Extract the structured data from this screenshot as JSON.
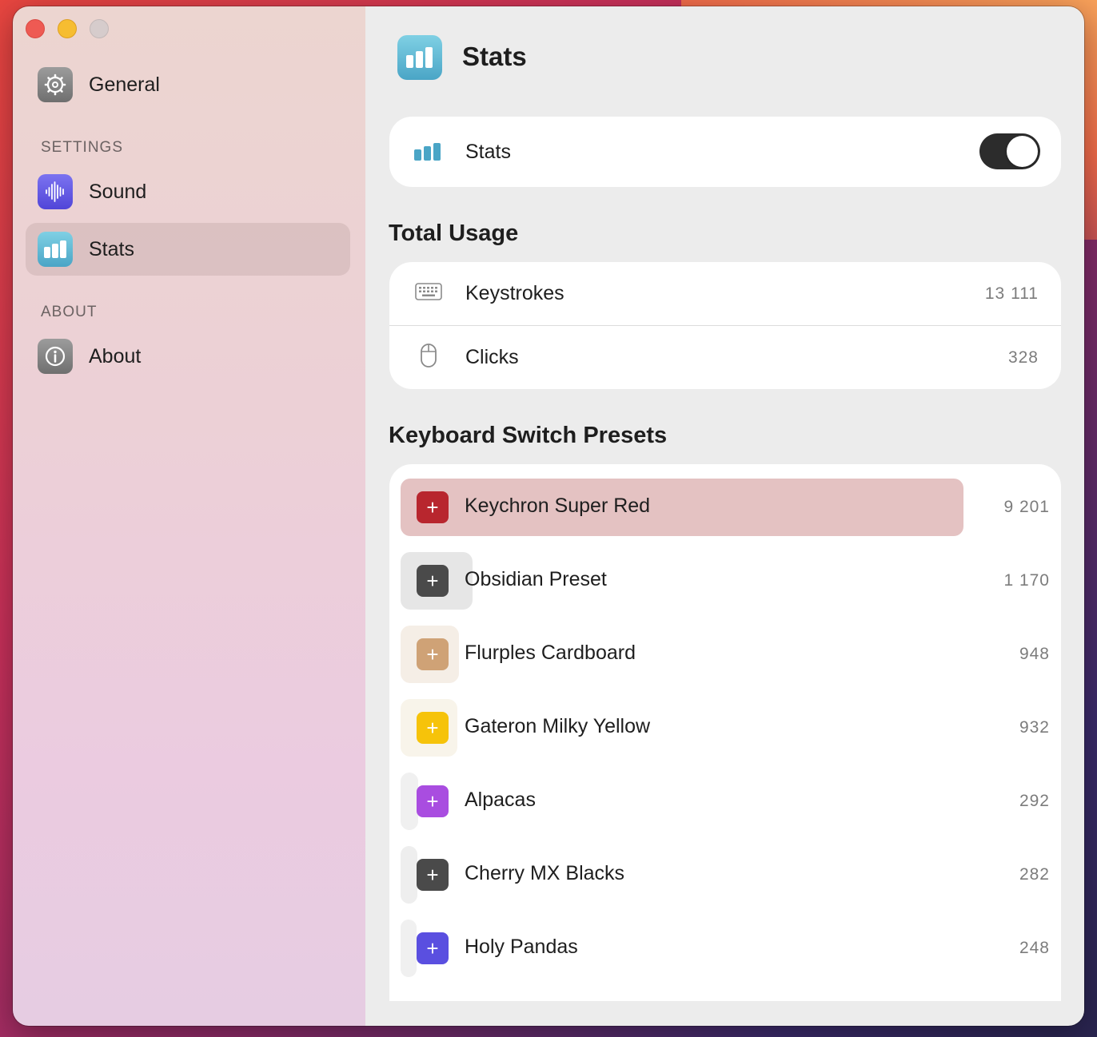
{
  "window": {
    "controls": [
      "close",
      "minimize",
      "zoom"
    ]
  },
  "sidebar": {
    "general": {
      "label": "General",
      "icon": "gear-icon"
    },
    "settings_header": "SETTINGS",
    "settings_items": [
      {
        "label": "Sound",
        "icon": "waveform-icon"
      },
      {
        "label": "Stats",
        "icon": "bar-chart-icon",
        "active": true
      }
    ],
    "about_header": "ABOUT",
    "about_items": [
      {
        "label": "About",
        "icon": "info-icon"
      }
    ]
  },
  "main": {
    "title": "Stats",
    "toggle": {
      "label": "Stats",
      "enabled": true
    },
    "total_usage": {
      "title": "Total Usage",
      "rows": [
        {
          "label": "Keystrokes",
          "value": "13 111",
          "icon": "keyboard-icon"
        },
        {
          "label": "Clicks",
          "value": "328",
          "icon": "mouse-icon"
        }
      ]
    },
    "presets": {
      "title": "Keyboard Switch Presets",
      "items": [
        {
          "name": "Keychron Super Red",
          "count": "9 201",
          "color": "#b8262e",
          "bar_color": "#e4c2c2",
          "share": 0.66
        },
        {
          "name": "Obsidian Preset",
          "count": "1 170",
          "color": "#4a4a4a",
          "bar_color": "#e6e6e6",
          "share": 0.084
        },
        {
          "name": "Flurples Cardboard",
          "count": "948",
          "color": "#cfa276",
          "bar_color": "#f5eee6",
          "share": 0.068
        },
        {
          "name": "Gateron Milky Yellow",
          "count": "932",
          "color": "#f6c30a",
          "bar_color": "#f8f4ea",
          "share": 0.067
        },
        {
          "name": "Alpacas",
          "count": "292",
          "color": "#a94de0",
          "bar_color": "#f0f0f0",
          "share": 0.021
        },
        {
          "name": "Cherry MX Blacks",
          "count": "282",
          "color": "#4a4a4a",
          "bar_color": "#eeeeee",
          "share": 0.02
        },
        {
          "name": "Holy Pandas",
          "count": "248",
          "color": "#5a4fe0",
          "bar_color": "#f0f0f0",
          "share": 0.018
        }
      ]
    }
  }
}
